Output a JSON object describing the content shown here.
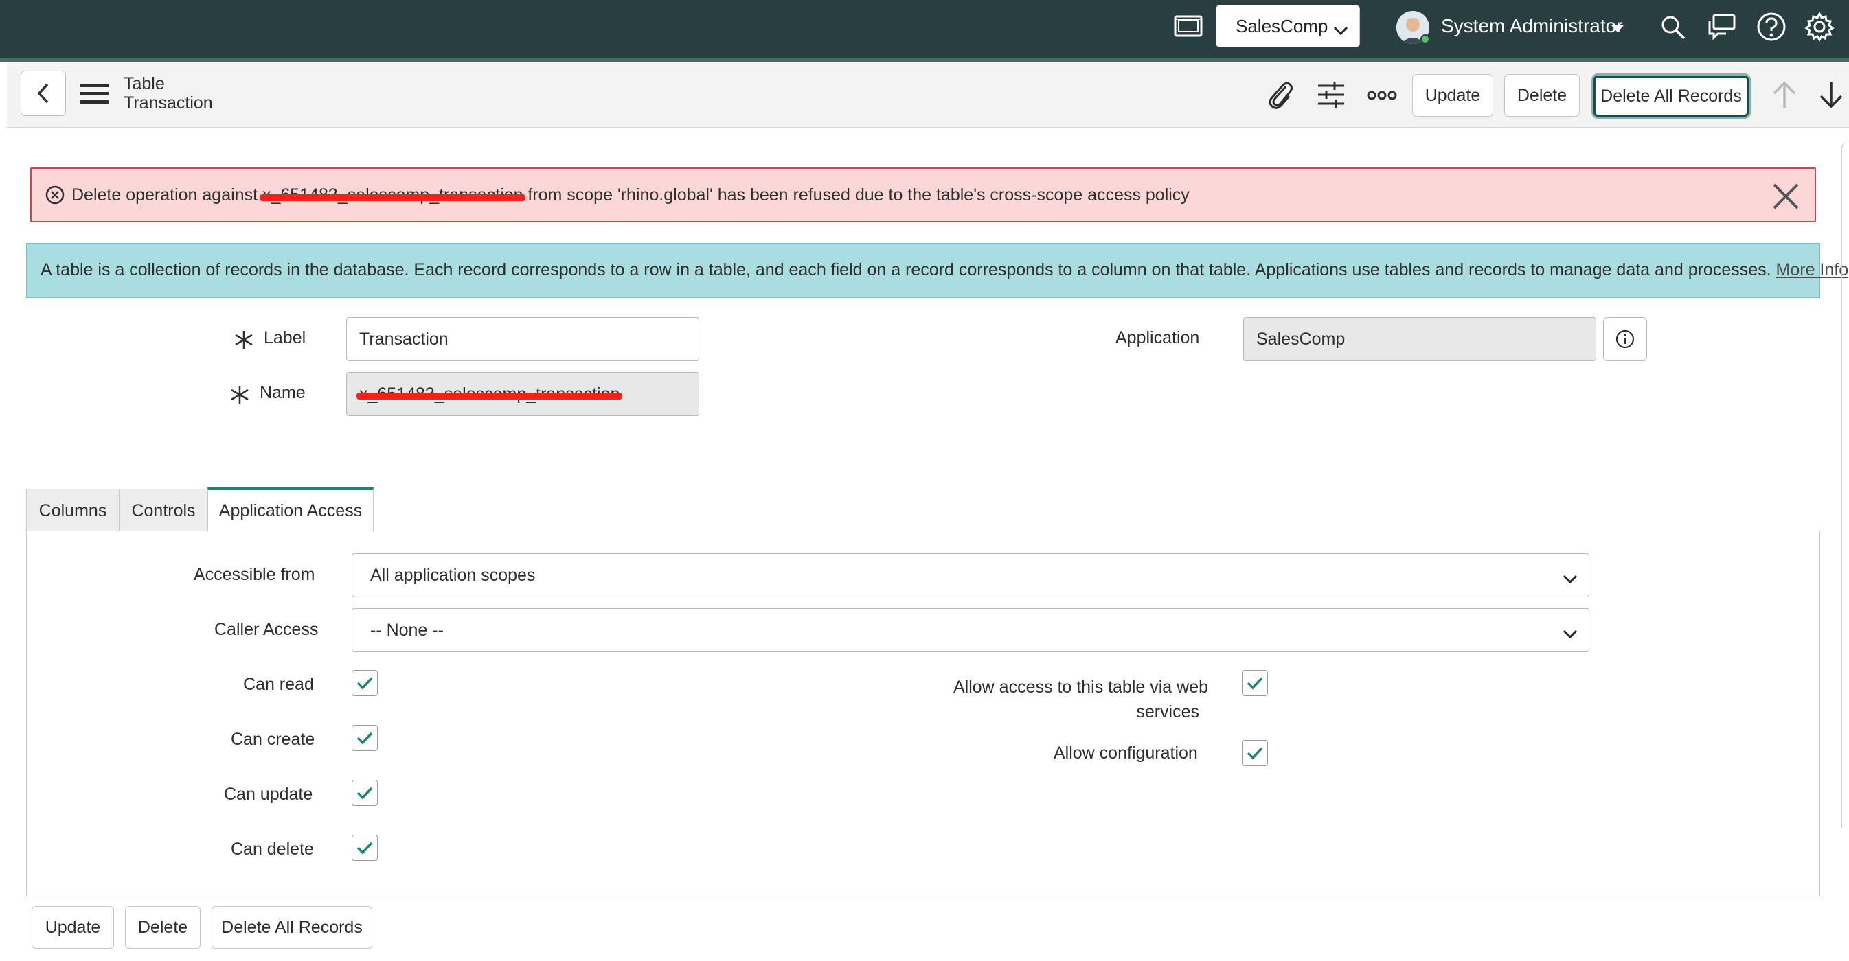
{
  "header": {
    "scope": "SalesComp",
    "user_name": "System Administrator"
  },
  "form": {
    "title_line1": "Table",
    "title_line2": "Transaction",
    "buttons": {
      "update": "Update",
      "delete": "Delete",
      "delete_all": "Delete All Records"
    }
  },
  "alerts": {
    "error_before": "Delete operation against ",
    "error_redacted": "x_651483_salescomp_transaction",
    "error_after": " from scope 'rhino.global' has been refused due to the table's cross-scope access policy",
    "info_text": "A table is a collection of records in the database. Each record corresponds to a row in a table, and each field on a record corresponds to a column on that table. Applications use tables and records to manage data and processes. ",
    "info_link": "More Info"
  },
  "fields": {
    "label_label": "Label",
    "label_value": "Transaction",
    "name_label": "Name",
    "name_value": "x_651483_salescomp_transaction",
    "application_label": "Application",
    "application_value": "SalesComp"
  },
  "tabs": [
    {
      "label": "Columns"
    },
    {
      "label": "Controls"
    },
    {
      "label": "Application Access"
    }
  ],
  "access": {
    "accessible_from_label": "Accessible from",
    "accessible_from_value": "All application scopes",
    "caller_access_label": "Caller Access",
    "caller_access_value": "-- None --",
    "can_read": "Can read",
    "can_create": "Can create",
    "can_update": "Can update",
    "can_delete": "Can delete",
    "web_services_line1": "Allow access to this table via web",
    "web_services_line2": "services",
    "allow_configuration": "Allow configuration"
  },
  "colors": {
    "banner": "#293e40",
    "accent": "#1f8476",
    "error_bg": "#fbd7d7",
    "info_bg": "#a9dde1"
  }
}
